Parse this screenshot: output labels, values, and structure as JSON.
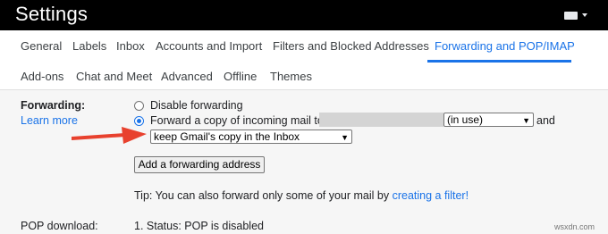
{
  "header": {
    "title": "Settings"
  },
  "tabs": [
    {
      "label": "General"
    },
    {
      "label": "Labels"
    },
    {
      "label": "Inbox"
    },
    {
      "label": "Accounts and Import"
    },
    {
      "label": "Filters and Blocked Addresses"
    },
    {
      "label": "Forwarding and POP/IMAP",
      "active": true
    },
    {
      "label": "Add-ons"
    },
    {
      "label": "Chat and Meet"
    },
    {
      "label": "Advanced"
    },
    {
      "label": "Offline"
    },
    {
      "label": "Themes"
    }
  ],
  "forwarding": {
    "label": "Forwarding:",
    "learn_more": "Learn more",
    "option_disable": "Disable forwarding",
    "option_forward": "Forward a copy of incoming mail to",
    "address_select": "(in use)",
    "and_text": "and",
    "action_select": "keep Gmail's copy in the Inbox",
    "add_button": "Add a forwarding address",
    "tip_prefix": "Tip: You can also forward only some of your mail by",
    "tip_link": "creating a filter!"
  },
  "pop": {
    "label": "POP download:",
    "status": "1. Status: POP is disabled"
  },
  "watermark": "wsxdn.com",
  "colors": {
    "accent": "#1a73e8",
    "arrow": "#e8412e",
    "topbar": "#000000"
  }
}
